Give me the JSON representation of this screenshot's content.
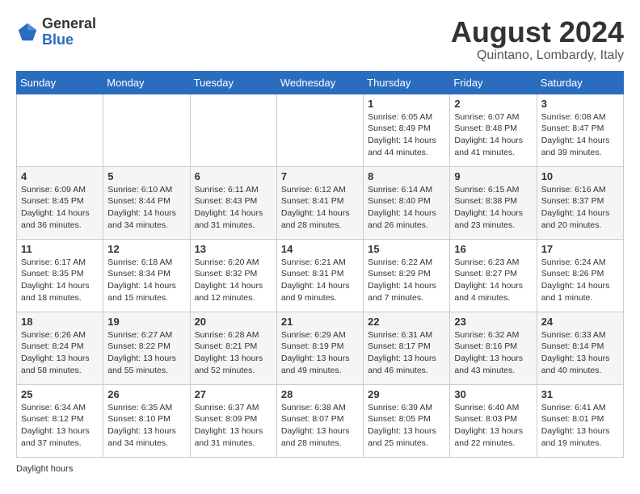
{
  "logo": {
    "general": "General",
    "blue": "Blue"
  },
  "title": {
    "month_year": "August 2024",
    "location": "Quintano, Lombardy, Italy"
  },
  "weekdays": [
    "Sunday",
    "Monday",
    "Tuesday",
    "Wednesday",
    "Thursday",
    "Friday",
    "Saturday"
  ],
  "weeks": [
    [
      {
        "day": "",
        "info": ""
      },
      {
        "day": "",
        "info": ""
      },
      {
        "day": "",
        "info": ""
      },
      {
        "day": "",
        "info": ""
      },
      {
        "day": "1",
        "info": "Sunrise: 6:05 AM\nSunset: 8:49 PM\nDaylight: 14 hours and 44 minutes."
      },
      {
        "day": "2",
        "info": "Sunrise: 6:07 AM\nSunset: 8:48 PM\nDaylight: 14 hours and 41 minutes."
      },
      {
        "day": "3",
        "info": "Sunrise: 6:08 AM\nSunset: 8:47 PM\nDaylight: 14 hours and 39 minutes."
      }
    ],
    [
      {
        "day": "4",
        "info": "Sunrise: 6:09 AM\nSunset: 8:45 PM\nDaylight: 14 hours and 36 minutes."
      },
      {
        "day": "5",
        "info": "Sunrise: 6:10 AM\nSunset: 8:44 PM\nDaylight: 14 hours and 34 minutes."
      },
      {
        "day": "6",
        "info": "Sunrise: 6:11 AM\nSunset: 8:43 PM\nDaylight: 14 hours and 31 minutes."
      },
      {
        "day": "7",
        "info": "Sunrise: 6:12 AM\nSunset: 8:41 PM\nDaylight: 14 hours and 28 minutes."
      },
      {
        "day": "8",
        "info": "Sunrise: 6:14 AM\nSunset: 8:40 PM\nDaylight: 14 hours and 26 minutes."
      },
      {
        "day": "9",
        "info": "Sunrise: 6:15 AM\nSunset: 8:38 PM\nDaylight: 14 hours and 23 minutes."
      },
      {
        "day": "10",
        "info": "Sunrise: 6:16 AM\nSunset: 8:37 PM\nDaylight: 14 hours and 20 minutes."
      }
    ],
    [
      {
        "day": "11",
        "info": "Sunrise: 6:17 AM\nSunset: 8:35 PM\nDaylight: 14 hours and 18 minutes."
      },
      {
        "day": "12",
        "info": "Sunrise: 6:18 AM\nSunset: 8:34 PM\nDaylight: 14 hours and 15 minutes."
      },
      {
        "day": "13",
        "info": "Sunrise: 6:20 AM\nSunset: 8:32 PM\nDaylight: 14 hours and 12 minutes."
      },
      {
        "day": "14",
        "info": "Sunrise: 6:21 AM\nSunset: 8:31 PM\nDaylight: 14 hours and 9 minutes."
      },
      {
        "day": "15",
        "info": "Sunrise: 6:22 AM\nSunset: 8:29 PM\nDaylight: 14 hours and 7 minutes."
      },
      {
        "day": "16",
        "info": "Sunrise: 6:23 AM\nSunset: 8:27 PM\nDaylight: 14 hours and 4 minutes."
      },
      {
        "day": "17",
        "info": "Sunrise: 6:24 AM\nSunset: 8:26 PM\nDaylight: 14 hours and 1 minute."
      }
    ],
    [
      {
        "day": "18",
        "info": "Sunrise: 6:26 AM\nSunset: 8:24 PM\nDaylight: 13 hours and 58 minutes."
      },
      {
        "day": "19",
        "info": "Sunrise: 6:27 AM\nSunset: 8:22 PM\nDaylight: 13 hours and 55 minutes."
      },
      {
        "day": "20",
        "info": "Sunrise: 6:28 AM\nSunset: 8:21 PM\nDaylight: 13 hours and 52 minutes."
      },
      {
        "day": "21",
        "info": "Sunrise: 6:29 AM\nSunset: 8:19 PM\nDaylight: 13 hours and 49 minutes."
      },
      {
        "day": "22",
        "info": "Sunrise: 6:31 AM\nSunset: 8:17 PM\nDaylight: 13 hours and 46 minutes."
      },
      {
        "day": "23",
        "info": "Sunrise: 6:32 AM\nSunset: 8:16 PM\nDaylight: 13 hours and 43 minutes."
      },
      {
        "day": "24",
        "info": "Sunrise: 6:33 AM\nSunset: 8:14 PM\nDaylight: 13 hours and 40 minutes."
      }
    ],
    [
      {
        "day": "25",
        "info": "Sunrise: 6:34 AM\nSunset: 8:12 PM\nDaylight: 13 hours and 37 minutes."
      },
      {
        "day": "26",
        "info": "Sunrise: 6:35 AM\nSunset: 8:10 PM\nDaylight: 13 hours and 34 minutes."
      },
      {
        "day": "27",
        "info": "Sunrise: 6:37 AM\nSunset: 8:09 PM\nDaylight: 13 hours and 31 minutes."
      },
      {
        "day": "28",
        "info": "Sunrise: 6:38 AM\nSunset: 8:07 PM\nDaylight: 13 hours and 28 minutes."
      },
      {
        "day": "29",
        "info": "Sunrise: 6:39 AM\nSunset: 8:05 PM\nDaylight: 13 hours and 25 minutes."
      },
      {
        "day": "30",
        "info": "Sunrise: 6:40 AM\nSunset: 8:03 PM\nDaylight: 13 hours and 22 minutes."
      },
      {
        "day": "31",
        "info": "Sunrise: 6:41 AM\nSunset: 8:01 PM\nDaylight: 13 hours and 19 minutes."
      }
    ]
  ],
  "footer": {
    "daylight_note": "Daylight hours"
  }
}
